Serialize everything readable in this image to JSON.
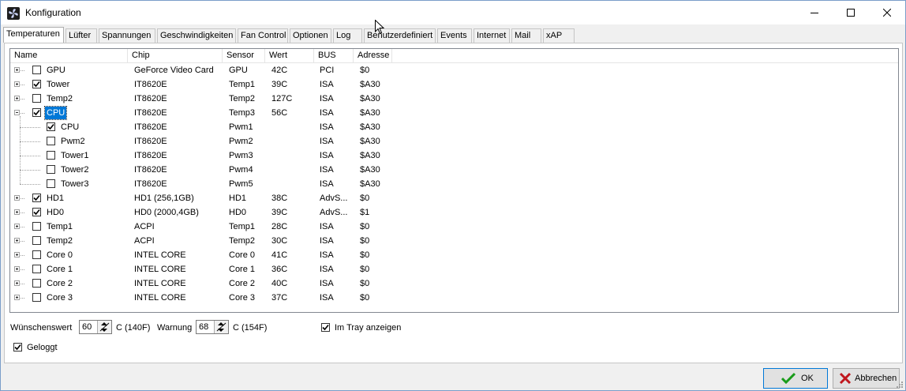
{
  "window": {
    "title": "Konfiguration"
  },
  "tabs": [
    "Temperaturen",
    "Lüfter",
    "Spannungen",
    "Geschwindigkeiten",
    "Fan Control",
    "Optionen",
    "Log",
    "Benutzerdefiniert",
    "Events",
    "Internet",
    "Mail",
    "xAP"
  ],
  "active_tab": "Temperaturen",
  "columns": [
    "Name",
    "Chip",
    "Sensor",
    "Wert",
    "BUS",
    "Adresse"
  ],
  "rows": [
    {
      "name": "GPU",
      "chip": "GeForce Video Card",
      "sensor": "GPU",
      "wert": "42C",
      "bus": "PCI",
      "adresse": "$0",
      "checked": false,
      "level": 0,
      "expander": "plus"
    },
    {
      "name": "Tower",
      "chip": "IT8620E",
      "sensor": "Temp1",
      "wert": "39C",
      "bus": "ISA",
      "adresse": "$A30",
      "checked": true,
      "level": 0,
      "expander": "plus"
    },
    {
      "name": "Temp2",
      "chip": "IT8620E",
      "sensor": "Temp2",
      "wert": "127C",
      "bus": "ISA",
      "adresse": "$A30",
      "checked": false,
      "level": 0,
      "expander": "plus"
    },
    {
      "name": "CPU",
      "chip": "IT8620E",
      "sensor": "Temp3",
      "wert": "56C",
      "bus": "ISA",
      "adresse": "$A30",
      "checked": true,
      "level": 0,
      "expander": "minus",
      "selected": true
    },
    {
      "name": "CPU",
      "chip": "IT8620E",
      "sensor": "Pwm1",
      "wert": "",
      "bus": "ISA",
      "adresse": "$A30",
      "checked": true,
      "level": 1
    },
    {
      "name": "Pwm2",
      "chip": "IT8620E",
      "sensor": "Pwm2",
      "wert": "",
      "bus": "ISA",
      "adresse": "$A30",
      "checked": false,
      "level": 1
    },
    {
      "name": "Tower1",
      "chip": "IT8620E",
      "sensor": "Pwm3",
      "wert": "",
      "bus": "ISA",
      "adresse": "$A30",
      "checked": false,
      "level": 1
    },
    {
      "name": "Tower2",
      "chip": "IT8620E",
      "sensor": "Pwm4",
      "wert": "",
      "bus": "ISA",
      "adresse": "$A30",
      "checked": false,
      "level": 1
    },
    {
      "name": "Tower3",
      "chip": "IT8620E",
      "sensor": "Pwm5",
      "wert": "",
      "bus": "ISA",
      "adresse": "$A30",
      "checked": false,
      "level": 1
    },
    {
      "name": "HD1",
      "chip": "HD1 (256,1GB)",
      "sensor": "HD1",
      "wert": "38C",
      "bus": "AdvS...",
      "adresse": "$0",
      "checked": true,
      "level": 0,
      "expander": "plus"
    },
    {
      "name": "HD0",
      "chip": "HD0 (2000,4GB)",
      "sensor": "HD0",
      "wert": "39C",
      "bus": "AdvS...",
      "adresse": "$1",
      "checked": true,
      "level": 0,
      "expander": "plus"
    },
    {
      "name": "Temp1",
      "chip": "ACPI",
      "sensor": "Temp1",
      "wert": "28C",
      "bus": "ISA",
      "adresse": "$0",
      "checked": false,
      "level": 0,
      "expander": "plus"
    },
    {
      "name": "Temp2",
      "chip": "ACPI",
      "sensor": "Temp2",
      "wert": "30C",
      "bus": "ISA",
      "adresse": "$0",
      "checked": false,
      "level": 0,
      "expander": "plus"
    },
    {
      "name": "Core 0",
      "chip": "INTEL CORE",
      "sensor": "Core 0",
      "wert": "41C",
      "bus": "ISA",
      "adresse": "$0",
      "checked": false,
      "level": 0,
      "expander": "plus"
    },
    {
      "name": "Core 1",
      "chip": "INTEL CORE",
      "sensor": "Core 1",
      "wert": "36C",
      "bus": "ISA",
      "adresse": "$0",
      "checked": false,
      "level": 0,
      "expander": "plus"
    },
    {
      "name": "Core 2",
      "chip": "INTEL CORE",
      "sensor": "Core 2",
      "wert": "40C",
      "bus": "ISA",
      "adresse": "$0",
      "checked": false,
      "level": 0,
      "expander": "plus"
    },
    {
      "name": "Core 3",
      "chip": "INTEL CORE",
      "sensor": "Core 3",
      "wert": "37C",
      "bus": "ISA",
      "adresse": "$0",
      "checked": false,
      "level": 0,
      "expander": "plus"
    }
  ],
  "options": {
    "wunschwert_label": "Wünschenswert",
    "wunschwert_value": "60",
    "wunschwert_unit": "C (140F)",
    "warnung_label": "Warnung",
    "warnung_value": "68",
    "warnung_unit": "C (154F)",
    "tray_label": "Im Tray anzeigen",
    "tray_checked": true,
    "geloggt_label": "Geloggt",
    "geloggt_checked": true
  },
  "buttons": {
    "ok_label": "OK",
    "cancel_label": "Abbrechen"
  },
  "colors": {
    "selection": "#0078d7",
    "ok_icon": "#1a9c1a",
    "cancel_icon": "#c0161d"
  },
  "icons": {
    "app": "fan-app-icon",
    "ok": "checkmark-icon",
    "cancel": "x-icon"
  }
}
